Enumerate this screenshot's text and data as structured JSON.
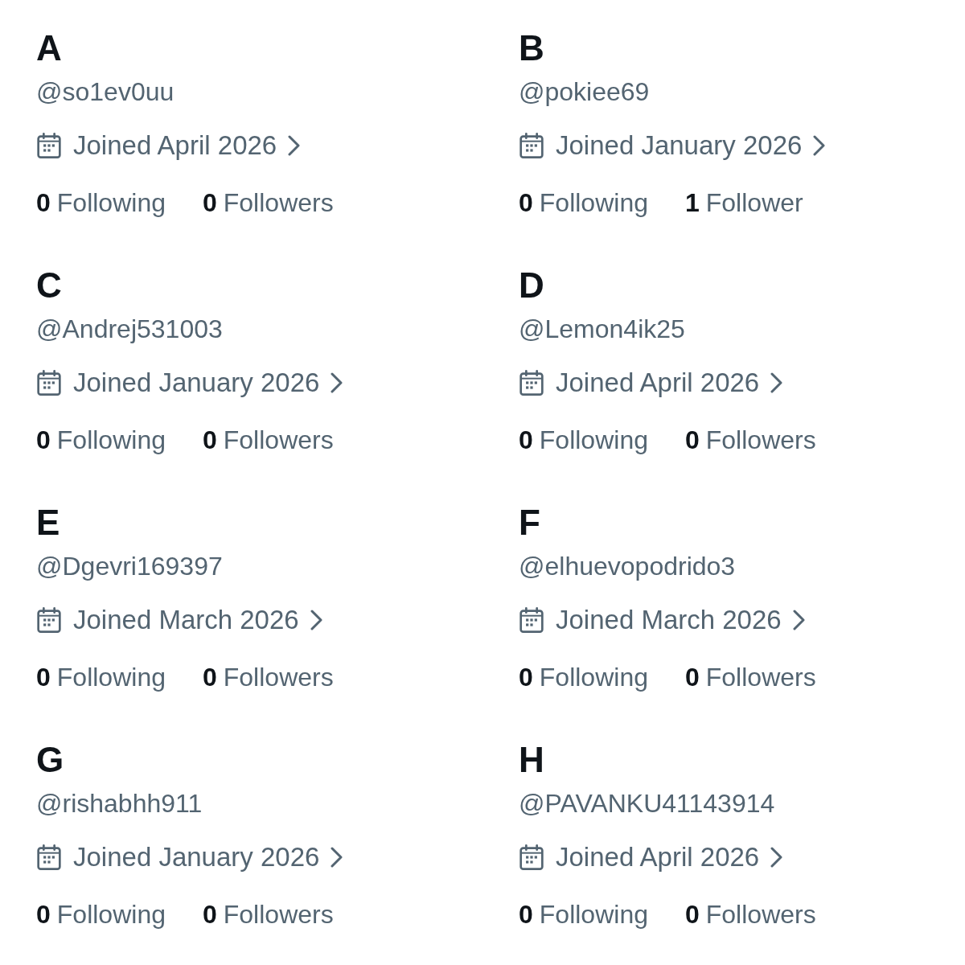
{
  "accounts": [
    {
      "letter": "A",
      "handle": "@so1ev0uu",
      "joined": "Joined April 2026",
      "stats": [
        {
          "count": "0",
          "label": "Following"
        },
        {
          "count": "0",
          "label": "Followers"
        }
      ]
    },
    {
      "letter": "B",
      "handle": "@pokiee69",
      "joined": "Joined January 2026",
      "stats": [
        {
          "count": "0",
          "label": "Following"
        },
        {
          "count": "1",
          "label": "Follower"
        }
      ]
    },
    {
      "letter": "C",
      "handle": "@Andrej531003",
      "joined": "Joined January 2026",
      "stats": [
        {
          "count": "0",
          "label": "Following"
        },
        {
          "count": "0",
          "label": "Followers"
        }
      ]
    },
    {
      "letter": "D",
      "handle": "@Lemon4ik25",
      "joined": "Joined April 2026",
      "stats": [
        {
          "count": "0",
          "label": "Following"
        },
        {
          "count": "0",
          "label": "Followers"
        }
      ]
    },
    {
      "letter": "E",
      "handle": "@Dgevri169397",
      "joined": "Joined March 2026",
      "stats": [
        {
          "count": "0",
          "label": "Following"
        },
        {
          "count": "0",
          "label": "Followers"
        }
      ]
    },
    {
      "letter": "F",
      "handle": "@elhuevopodrido3",
      "joined": "Joined March 2026",
      "stats": [
        {
          "count": "0",
          "label": "Following"
        },
        {
          "count": "0",
          "label": "Followers"
        }
      ]
    },
    {
      "letter": "G",
      "handle": "@rishabhh911",
      "joined": "Joined January 2026",
      "stats": [
        {
          "count": "0",
          "label": "Following"
        },
        {
          "count": "0",
          "label": "Followers"
        }
      ]
    },
    {
      "letter": "H",
      "handle": "@PAVANKU41143914",
      "joined": "Joined April 2026",
      "stats": [
        {
          "count": "0",
          "label": "Following"
        },
        {
          "count": "0",
          "label": "Followers"
        }
      ]
    }
  ]
}
